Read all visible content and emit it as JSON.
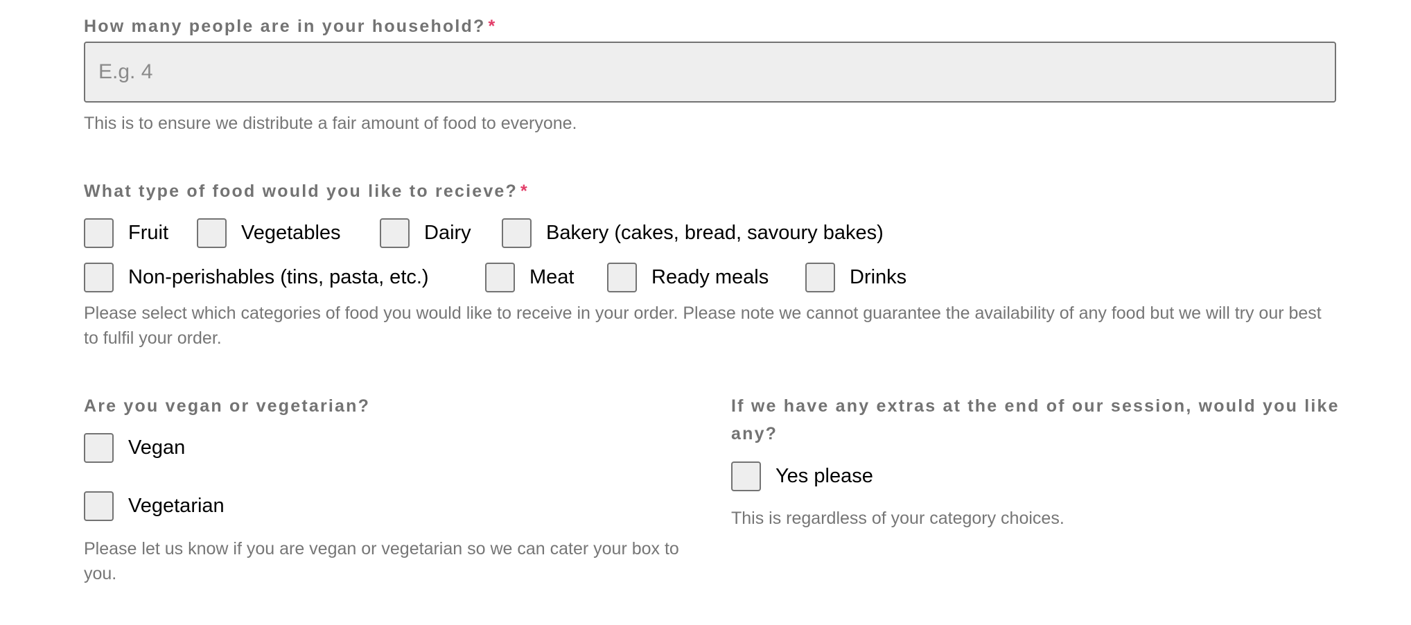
{
  "household": {
    "label": "How many people are in your household?",
    "required_mark": "*",
    "input_value": "",
    "placeholder": "E.g. 4",
    "helper": "This is to ensure we distribute a fair amount of food to everyone."
  },
  "food_types": {
    "label": "What type of food would you like to recieve?",
    "required_mark": "*",
    "options": [
      {
        "label": "Fruit",
        "checked": false
      },
      {
        "label": "Vegetables",
        "checked": false
      },
      {
        "label": "Dairy",
        "checked": false
      },
      {
        "label": "Bakery (cakes, bread, savoury bakes)",
        "checked": false
      },
      {
        "label": "Non-perishables (tins, pasta, etc.)",
        "checked": false
      },
      {
        "label": "Meat",
        "checked": false
      },
      {
        "label": "Ready meals",
        "checked": false
      },
      {
        "label": "Drinks",
        "checked": false
      }
    ],
    "helper": "Please select which categories of food you would like to receive in your order. Please note we cannot guarantee the availability of any food but we will try our best to fulfil your order."
  },
  "diet": {
    "label": "Are you vegan or vegetarian?",
    "options": [
      {
        "label": "Vegan",
        "checked": false
      },
      {
        "label": "Vegetarian",
        "checked": false
      }
    ],
    "helper": "Please let us know if you are vegan or vegetarian so we can cater your box to you."
  },
  "extras": {
    "label": "If we have any extras at the end of our session, would you like any?",
    "options": [
      {
        "label": "Yes please",
        "checked": false
      }
    ],
    "helper": "This is regardless of your category choices."
  },
  "colors": {
    "required": "#e23d68",
    "label_text": "#737373",
    "checkbox_fill": "#eeeeee",
    "checkbox_border": "#737373"
  }
}
